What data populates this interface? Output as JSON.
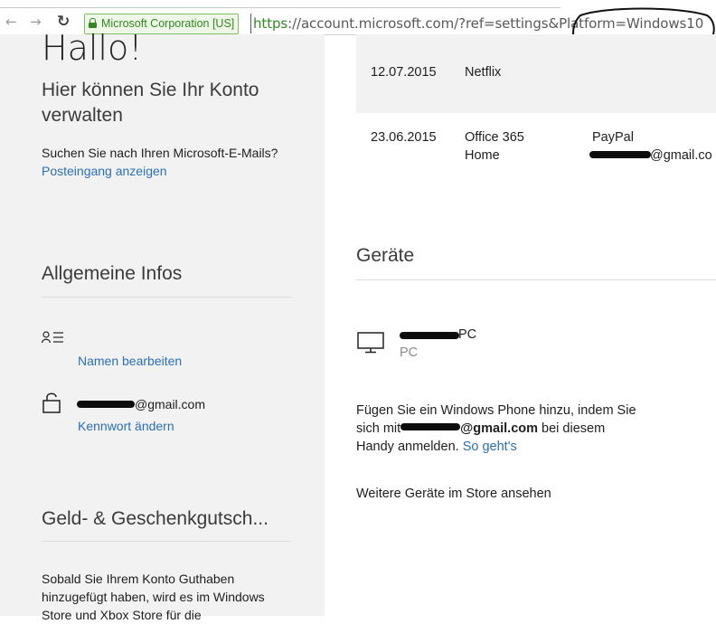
{
  "browser": {
    "ev_badge": "Microsoft Corporation [US]",
    "url_scheme": "https",
    "url_rest": "://account.microsoft.com/?ref=settings&Platform=Windows10"
  },
  "left": {
    "greeting": "Hallo!",
    "subtitle": "Hier können Sie Ihr Konto verwalten",
    "email_question": "Suchen Sie nach Ihren Microsoft-E-Mails?",
    "inbox_link": "Posteingang anzeigen",
    "general_heading": "Allgemeine Infos",
    "edit_name_link": "Namen bearbeiten",
    "email_suffix": "@gmail.com",
    "change_password_link": "Kennwort ändern",
    "money_heading": "Geld- & Geschenkgutsch...",
    "money_text": "Sobald Sie Ihrem Konto Guthaben hinzugefügt haben, wird es im Windows Store und Xbox Store für die"
  },
  "purchases": [
    {
      "date": "12.07.2015",
      "item": "Netflix",
      "payment": "",
      "account": ""
    },
    {
      "date": "23.06.2015",
      "item": "Office 365 Home",
      "payment": "PayPal",
      "account": "@gmail.co"
    }
  ],
  "devices": {
    "heading": "Geräte",
    "device_name_suffix": "PC",
    "device_type": "PC",
    "phone_text_1": "Fügen Sie ein Windows Phone hinzu, indem Sie",
    "phone_text_2a": "sich mit",
    "phone_email": "@gmail.com",
    "phone_text_2b": "bei diesem",
    "phone_text_3": "Handy anmelden.",
    "how_link": "So geht's",
    "store_link": "Weitere Geräte im Store ansehen"
  },
  "colors": {
    "link": "#2a6fbd",
    "ev_green": "#2f8b1f",
    "pane_bg": "#f2f2f2"
  }
}
